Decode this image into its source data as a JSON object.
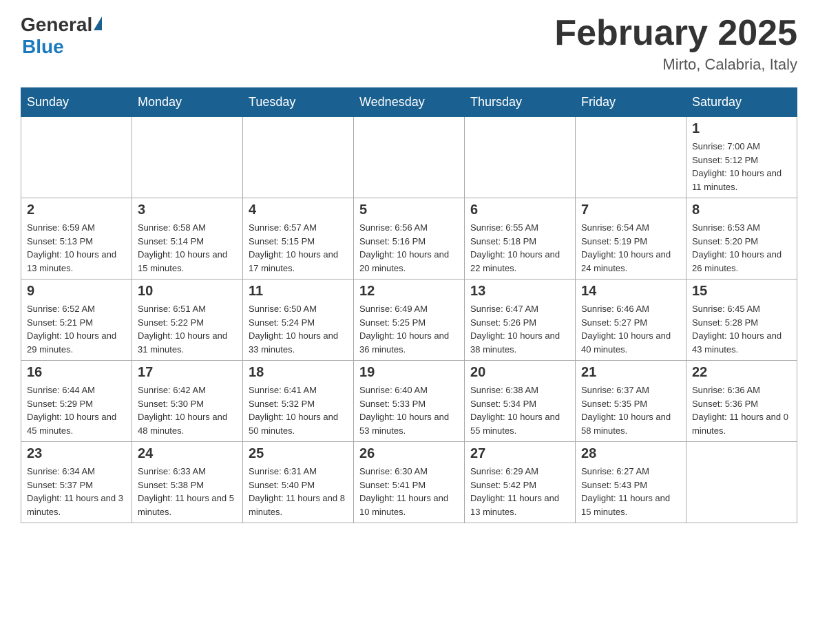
{
  "header": {
    "logo": {
      "general": "General",
      "blue": "Blue"
    },
    "title": "February 2025",
    "location": "Mirto, Calabria, Italy"
  },
  "weekdays": [
    "Sunday",
    "Monday",
    "Tuesday",
    "Wednesday",
    "Thursday",
    "Friday",
    "Saturday"
  ],
  "weeks": [
    [
      {
        "day": "",
        "sunrise": "",
        "sunset": "",
        "daylight": ""
      },
      {
        "day": "",
        "sunrise": "",
        "sunset": "",
        "daylight": ""
      },
      {
        "day": "",
        "sunrise": "",
        "sunset": "",
        "daylight": ""
      },
      {
        "day": "",
        "sunrise": "",
        "sunset": "",
        "daylight": ""
      },
      {
        "day": "",
        "sunrise": "",
        "sunset": "",
        "daylight": ""
      },
      {
        "day": "",
        "sunrise": "",
        "sunset": "",
        "daylight": ""
      },
      {
        "day": "1",
        "sunrise": "Sunrise: 7:00 AM",
        "sunset": "Sunset: 5:12 PM",
        "daylight": "Daylight: 10 hours and 11 minutes."
      }
    ],
    [
      {
        "day": "2",
        "sunrise": "Sunrise: 6:59 AM",
        "sunset": "Sunset: 5:13 PM",
        "daylight": "Daylight: 10 hours and 13 minutes."
      },
      {
        "day": "3",
        "sunrise": "Sunrise: 6:58 AM",
        "sunset": "Sunset: 5:14 PM",
        "daylight": "Daylight: 10 hours and 15 minutes."
      },
      {
        "day": "4",
        "sunrise": "Sunrise: 6:57 AM",
        "sunset": "Sunset: 5:15 PM",
        "daylight": "Daylight: 10 hours and 17 minutes."
      },
      {
        "day": "5",
        "sunrise": "Sunrise: 6:56 AM",
        "sunset": "Sunset: 5:16 PM",
        "daylight": "Daylight: 10 hours and 20 minutes."
      },
      {
        "day": "6",
        "sunrise": "Sunrise: 6:55 AM",
        "sunset": "Sunset: 5:18 PM",
        "daylight": "Daylight: 10 hours and 22 minutes."
      },
      {
        "day": "7",
        "sunrise": "Sunrise: 6:54 AM",
        "sunset": "Sunset: 5:19 PM",
        "daylight": "Daylight: 10 hours and 24 minutes."
      },
      {
        "day": "8",
        "sunrise": "Sunrise: 6:53 AM",
        "sunset": "Sunset: 5:20 PM",
        "daylight": "Daylight: 10 hours and 26 minutes."
      }
    ],
    [
      {
        "day": "9",
        "sunrise": "Sunrise: 6:52 AM",
        "sunset": "Sunset: 5:21 PM",
        "daylight": "Daylight: 10 hours and 29 minutes."
      },
      {
        "day": "10",
        "sunrise": "Sunrise: 6:51 AM",
        "sunset": "Sunset: 5:22 PM",
        "daylight": "Daylight: 10 hours and 31 minutes."
      },
      {
        "day": "11",
        "sunrise": "Sunrise: 6:50 AM",
        "sunset": "Sunset: 5:24 PM",
        "daylight": "Daylight: 10 hours and 33 minutes."
      },
      {
        "day": "12",
        "sunrise": "Sunrise: 6:49 AM",
        "sunset": "Sunset: 5:25 PM",
        "daylight": "Daylight: 10 hours and 36 minutes."
      },
      {
        "day": "13",
        "sunrise": "Sunrise: 6:47 AM",
        "sunset": "Sunset: 5:26 PM",
        "daylight": "Daylight: 10 hours and 38 minutes."
      },
      {
        "day": "14",
        "sunrise": "Sunrise: 6:46 AM",
        "sunset": "Sunset: 5:27 PM",
        "daylight": "Daylight: 10 hours and 40 minutes."
      },
      {
        "day": "15",
        "sunrise": "Sunrise: 6:45 AM",
        "sunset": "Sunset: 5:28 PM",
        "daylight": "Daylight: 10 hours and 43 minutes."
      }
    ],
    [
      {
        "day": "16",
        "sunrise": "Sunrise: 6:44 AM",
        "sunset": "Sunset: 5:29 PM",
        "daylight": "Daylight: 10 hours and 45 minutes."
      },
      {
        "day": "17",
        "sunrise": "Sunrise: 6:42 AM",
        "sunset": "Sunset: 5:30 PM",
        "daylight": "Daylight: 10 hours and 48 minutes."
      },
      {
        "day": "18",
        "sunrise": "Sunrise: 6:41 AM",
        "sunset": "Sunset: 5:32 PM",
        "daylight": "Daylight: 10 hours and 50 minutes."
      },
      {
        "day": "19",
        "sunrise": "Sunrise: 6:40 AM",
        "sunset": "Sunset: 5:33 PM",
        "daylight": "Daylight: 10 hours and 53 minutes."
      },
      {
        "day": "20",
        "sunrise": "Sunrise: 6:38 AM",
        "sunset": "Sunset: 5:34 PM",
        "daylight": "Daylight: 10 hours and 55 minutes."
      },
      {
        "day": "21",
        "sunrise": "Sunrise: 6:37 AM",
        "sunset": "Sunset: 5:35 PM",
        "daylight": "Daylight: 10 hours and 58 minutes."
      },
      {
        "day": "22",
        "sunrise": "Sunrise: 6:36 AM",
        "sunset": "Sunset: 5:36 PM",
        "daylight": "Daylight: 11 hours and 0 minutes."
      }
    ],
    [
      {
        "day": "23",
        "sunrise": "Sunrise: 6:34 AM",
        "sunset": "Sunset: 5:37 PM",
        "daylight": "Daylight: 11 hours and 3 minutes."
      },
      {
        "day": "24",
        "sunrise": "Sunrise: 6:33 AM",
        "sunset": "Sunset: 5:38 PM",
        "daylight": "Daylight: 11 hours and 5 minutes."
      },
      {
        "day": "25",
        "sunrise": "Sunrise: 6:31 AM",
        "sunset": "Sunset: 5:40 PM",
        "daylight": "Daylight: 11 hours and 8 minutes."
      },
      {
        "day": "26",
        "sunrise": "Sunrise: 6:30 AM",
        "sunset": "Sunset: 5:41 PM",
        "daylight": "Daylight: 11 hours and 10 minutes."
      },
      {
        "day": "27",
        "sunrise": "Sunrise: 6:29 AM",
        "sunset": "Sunset: 5:42 PM",
        "daylight": "Daylight: 11 hours and 13 minutes."
      },
      {
        "day": "28",
        "sunrise": "Sunrise: 6:27 AM",
        "sunset": "Sunset: 5:43 PM",
        "daylight": "Daylight: 11 hours and 15 minutes."
      },
      {
        "day": "",
        "sunrise": "",
        "sunset": "",
        "daylight": ""
      }
    ]
  ]
}
